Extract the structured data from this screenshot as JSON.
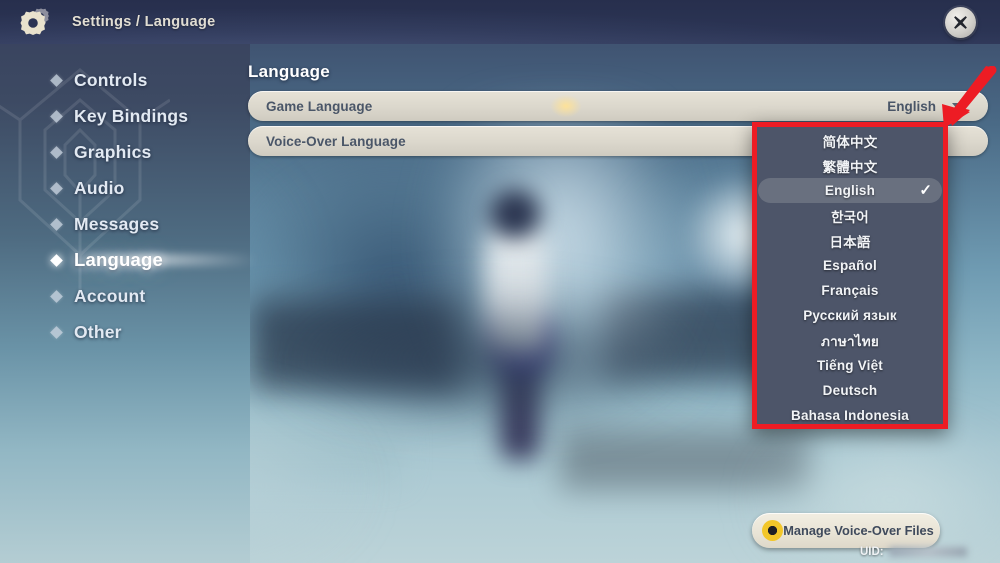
{
  "window": {
    "title": "Settings / Language",
    "gear_icon": "gear-icon",
    "close_icon": "close-x-icon"
  },
  "sidebar": {
    "items": [
      {
        "label": "Controls",
        "selected": false
      },
      {
        "label": "Key Bindings",
        "selected": false
      },
      {
        "label": "Graphics",
        "selected": false
      },
      {
        "label": "Audio",
        "selected": false
      },
      {
        "label": "Messages",
        "selected": false
      },
      {
        "label": "Language",
        "selected": true
      },
      {
        "label": "Account",
        "selected": false
      },
      {
        "label": "Other",
        "selected": false
      }
    ]
  },
  "content": {
    "section_title": "Language",
    "rows": [
      {
        "label": "Game Language",
        "value": "English",
        "has_caret": true
      },
      {
        "label": "Voice-Over Language",
        "value": "",
        "has_caret": false
      }
    ]
  },
  "dropdown": {
    "open": true,
    "selected": "English",
    "check_glyph": "✓",
    "options": [
      {
        "label": "简体中文",
        "selected": false
      },
      {
        "label": "繁體中文",
        "selected": false
      },
      {
        "label": "English",
        "selected": true
      },
      {
        "label": "한국어",
        "selected": false
      },
      {
        "label": "日本語",
        "selected": false
      },
      {
        "label": "Español",
        "selected": false
      },
      {
        "label": "Français",
        "selected": false
      },
      {
        "label": "Русский язык",
        "selected": false
      },
      {
        "label": "ภาษาไทย",
        "selected": false
      },
      {
        "label": "Tiếng Việt",
        "selected": false
      },
      {
        "label": "Deutsch",
        "selected": false
      },
      {
        "label": "Bahasa Indonesia",
        "selected": false
      }
    ]
  },
  "footer": {
    "manage_button_label": "Manage Voice-Over Files",
    "manage_button_icon": "flower-gear-icon",
    "uid_label": "UID:",
    "uid_value_redacted": true
  },
  "annotations": {
    "highlight_box_color": "#ed1c24",
    "arrow_color": "#ed1c24",
    "arrow_direction": "down-left",
    "arrow_target": "game-language-dropdown"
  },
  "colors": {
    "header_bg": "#2b3454",
    "panel_bg": "#4d5569",
    "selected_option_bg": "#69707f",
    "row_bg": "#e6e2d7",
    "row_text": "#4a5668",
    "nav_text": "#e2e9f2",
    "accent_red": "#ed1c24",
    "flower_yellow": "#f2c629"
  }
}
